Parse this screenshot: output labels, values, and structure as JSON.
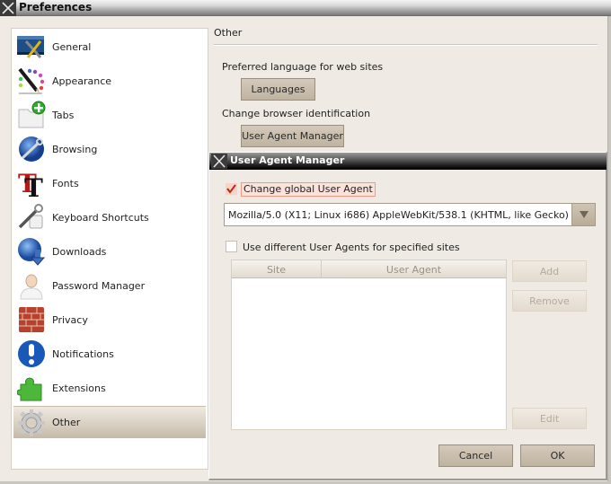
{
  "window": {
    "title": "Preferences"
  },
  "sidebar": {
    "items": [
      {
        "label": "General",
        "icon": "general-settings-icon",
        "selected": false
      },
      {
        "label": "Appearance",
        "icon": "appearance-paint-icon",
        "selected": false
      },
      {
        "label": "Tabs",
        "icon": "tabs-add-icon",
        "selected": false
      },
      {
        "label": "Browsing",
        "icon": "browsing-globe-wrench-icon",
        "selected": false
      },
      {
        "label": "Fonts",
        "icon": "fonts-icon",
        "selected": false
      },
      {
        "label": "Keyboard Shortcuts",
        "icon": "keyboard-shortcuts-icon",
        "selected": false
      },
      {
        "label": "Downloads",
        "icon": "downloads-icon",
        "selected": false
      },
      {
        "label": "Password Manager",
        "icon": "password-manager-user-icon",
        "selected": false
      },
      {
        "label": "Privacy",
        "icon": "privacy-brick-wall-icon",
        "selected": false
      },
      {
        "label": "Notifications",
        "icon": "notifications-info-icon",
        "selected": false
      },
      {
        "label": "Extensions",
        "icon": "extensions-puzzle-icon",
        "selected": false
      },
      {
        "label": "Other",
        "icon": "other-gear-icon",
        "selected": true
      }
    ]
  },
  "panel": {
    "title": "Other",
    "language_label": "Preferred language for web sites",
    "languages_button": "Languages",
    "identification_label": "Change browser identification",
    "user_agent_manager_button": "User Agent Manager"
  },
  "dialog": {
    "title": "User Agent Manager",
    "change_global_label": "Change global User Agent",
    "change_global_checked": true,
    "user_agent_value": "Mozilla/5.0 (X11; Linux i686) AppleWebKit/538.1 (KHTML, like Gecko) QtTestBro",
    "use_different_label": "Use different User Agents for specified sites",
    "use_different_checked": false,
    "table": {
      "columns": [
        "Site",
        "User Agent"
      ],
      "rows": []
    },
    "add_button": "Add",
    "remove_button": "Remove",
    "edit_button": "Edit",
    "cancel_button": "Cancel",
    "ok_button": "OK"
  }
}
